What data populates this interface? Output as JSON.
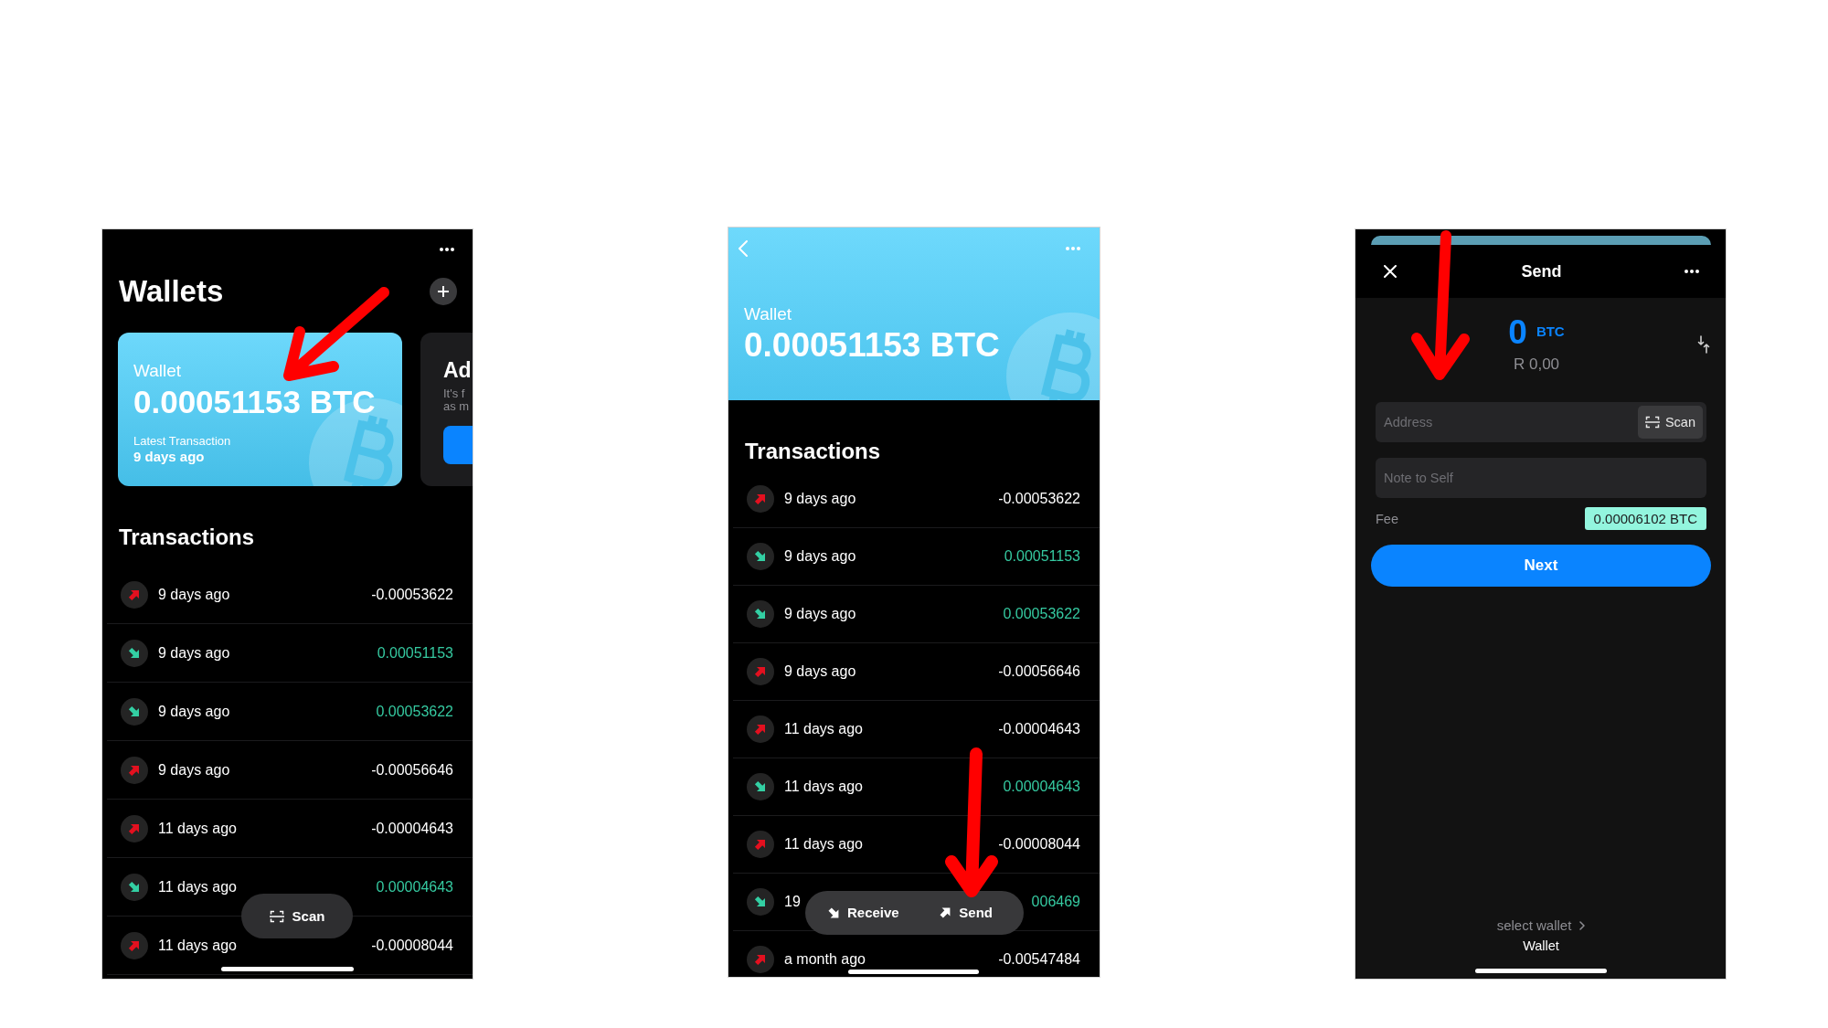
{
  "wallets_screen": {
    "title": "Wallets",
    "cards": [
      {
        "kind": "wallet",
        "label": "Wallet",
        "balance": "0.00051153 BTC",
        "latest_label": "Latest Transaction",
        "latest_value": "9 days ago"
      },
      {
        "kind": "promo",
        "title": "Ad",
        "lines": [
          "It's f",
          "as m"
        ]
      }
    ],
    "section_title": "Transactions",
    "transactions": [
      {
        "kind": "sent",
        "date": "9 days ago",
        "amount": "-0.00053622"
      },
      {
        "kind": "received",
        "date": "9 days ago",
        "amount": "0.00051153"
      },
      {
        "kind": "received",
        "date": "9 days ago",
        "amount": "0.00053622"
      },
      {
        "kind": "sent",
        "date": "9 days ago",
        "amount": "-0.00056646"
      },
      {
        "kind": "sent",
        "date": "11 days ago",
        "amount": "-0.00004643"
      },
      {
        "kind": "received",
        "date": "11 days ago",
        "amount": "0.00004643"
      },
      {
        "kind": "sent",
        "date": "11 days ago",
        "amount": "-0.00008044"
      }
    ],
    "scan_button": "Scan"
  },
  "wallet_screen": {
    "label": "Wallet",
    "balance": "0.00051153 BTC",
    "section_title": "Transactions",
    "transactions": [
      {
        "kind": "sent",
        "date": "9 days ago",
        "amount": "-0.00053622"
      },
      {
        "kind": "received",
        "date": "9 days ago",
        "amount": "0.00051153"
      },
      {
        "kind": "received",
        "date": "9 days ago",
        "amount": "0.00053622"
      },
      {
        "kind": "sent",
        "date": "9 days ago",
        "amount": "-0.00056646"
      },
      {
        "kind": "sent",
        "date": "11 days ago",
        "amount": "-0.00004643"
      },
      {
        "kind": "received",
        "date": "11 days ago",
        "amount": "0.00004643"
      },
      {
        "kind": "sent",
        "date": "11 days ago",
        "amount": "-0.00008044"
      },
      {
        "kind": "received",
        "date": "19",
        "amount": "006469"
      },
      {
        "kind": "sent",
        "date": "a month ago",
        "amount": "-0.00547484"
      }
    ],
    "actions": [
      {
        "kind": "receive",
        "label": "Receive"
      },
      {
        "kind": "send",
        "label": "Send"
      }
    ]
  },
  "send_screen": {
    "title": "Send",
    "amount": "0",
    "unit": "BTC",
    "fiat": "R 0,00",
    "address_field": {
      "placeholder": "Address",
      "scan_label": "Scan"
    },
    "note_field": {
      "placeholder": "Note to Self"
    },
    "fee": {
      "label": "Fee",
      "value": "0.00006102 BTC"
    },
    "next_button": "Next",
    "wallet_picker": {
      "label": "select wallet",
      "value": "Wallet"
    }
  }
}
